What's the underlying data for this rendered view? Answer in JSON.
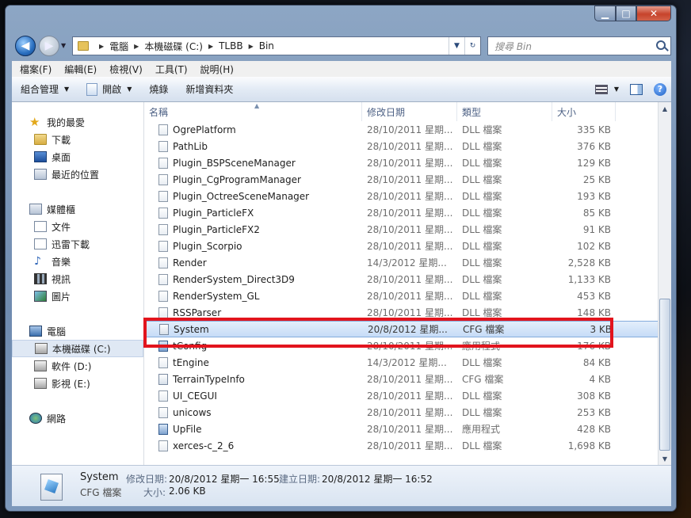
{
  "window_controls": {
    "minimize": "▁",
    "maximize": "□",
    "close": "✕"
  },
  "address": {
    "crumbs": [
      "電腦",
      "本機磁碟 (C:)",
      "TLBB",
      "Bin"
    ]
  },
  "search": {
    "placeholder": "搜尋 Bin"
  },
  "menu": [
    "檔案(F)",
    "編輯(E)",
    "檢視(V)",
    "工具(T)",
    "說明(H)"
  ],
  "toolbar": {
    "organize": "組合管理",
    "open": "開啟",
    "burn": "燒錄",
    "new_folder": "新增資料夾"
  },
  "sidebar": {
    "favorites": {
      "label": "我的最愛",
      "items": [
        "下載",
        "桌面",
        "最近的位置"
      ]
    },
    "libraries": {
      "label": "媒體櫃",
      "items": [
        "文件",
        "迅雷下載",
        "音樂",
        "視訊",
        "圖片"
      ]
    },
    "computer": {
      "label": "電腦",
      "items": [
        "本機磁碟 (C:)",
        "軟件 (D:)",
        "影視 (E:)"
      ]
    },
    "network": {
      "label": "網路"
    }
  },
  "columns": {
    "name": "名稱",
    "modified": "修改日期",
    "type": "類型",
    "size": "大小"
  },
  "files": [
    {
      "name": "OgrePlatform",
      "date": "28/10/2011 星期...",
      "type": "DLL 檔案",
      "size": "335 KB",
      "icon": "file"
    },
    {
      "name": "PathLib",
      "date": "28/10/2011 星期...",
      "type": "DLL 檔案",
      "size": "376 KB",
      "icon": "file"
    },
    {
      "name": "Plugin_BSPSceneManager",
      "date": "28/10/2011 星期...",
      "type": "DLL 檔案",
      "size": "129 KB",
      "icon": "file"
    },
    {
      "name": "Plugin_CgProgramManager",
      "date": "28/10/2011 星期...",
      "type": "DLL 檔案",
      "size": "25 KB",
      "icon": "file"
    },
    {
      "name": "Plugin_OctreeSceneManager",
      "date": "28/10/2011 星期...",
      "type": "DLL 檔案",
      "size": "193 KB",
      "icon": "file"
    },
    {
      "name": "Plugin_ParticleFX",
      "date": "28/10/2011 星期...",
      "type": "DLL 檔案",
      "size": "85 KB",
      "icon": "file"
    },
    {
      "name": "Plugin_ParticleFX2",
      "date": "28/10/2011 星期...",
      "type": "DLL 檔案",
      "size": "91 KB",
      "icon": "file"
    },
    {
      "name": "Plugin_Scorpio",
      "date": "28/10/2011 星期...",
      "type": "DLL 檔案",
      "size": "102 KB",
      "icon": "file"
    },
    {
      "name": "Render",
      "date": "14/3/2012 星期...",
      "type": "DLL 檔案",
      "size": "2,528 KB",
      "icon": "file"
    },
    {
      "name": "RenderSystem_Direct3D9",
      "date": "28/10/2011 星期...",
      "type": "DLL 檔案",
      "size": "1,133 KB",
      "icon": "file"
    },
    {
      "name": "RenderSystem_GL",
      "date": "28/10/2011 星期...",
      "type": "DLL 檔案",
      "size": "453 KB",
      "icon": "file"
    },
    {
      "name": "RSSParser",
      "date": "28/10/2011 星期...",
      "type": "DLL 檔案",
      "size": "148 KB",
      "icon": "file"
    },
    {
      "name": "System",
      "date": "20/8/2012 星期...",
      "type": "CFG 檔案",
      "size": "3 KB",
      "icon": "cfg",
      "selected": true
    },
    {
      "name": "tConfig",
      "date": "28/10/2011 星期...",
      "type": "應用程式",
      "size": "176 KB",
      "icon": "exe"
    },
    {
      "name": "tEngine",
      "date": "14/3/2012 星期...",
      "type": "DLL 檔案",
      "size": "84 KB",
      "icon": "file"
    },
    {
      "name": "TerrainTypeInfo",
      "date": "28/10/2011 星期...",
      "type": "CFG 檔案",
      "size": "4 KB",
      "icon": "cfg"
    },
    {
      "name": "UI_CEGUI",
      "date": "28/10/2011 星期...",
      "type": "DLL 檔案",
      "size": "308 KB",
      "icon": "file"
    },
    {
      "name": "unicows",
      "date": "28/10/2011 星期...",
      "type": "DLL 檔案",
      "size": "253 KB",
      "icon": "file"
    },
    {
      "name": "UpFile",
      "date": "28/10/2011 星期...",
      "type": "應用程式",
      "size": "428 KB",
      "icon": "exe"
    },
    {
      "name": "xerces-c_2_6",
      "date": "28/10/2011 星期...",
      "type": "DLL 檔案",
      "size": "1,698 KB",
      "icon": "file"
    }
  ],
  "details": {
    "name": "System",
    "type": "CFG 檔案",
    "modified_label": "修改日期:",
    "modified": "20/8/2012 星期一 16:55",
    "created_label": "建立日期:",
    "created": "20/8/2012 星期一 16:52",
    "size_label": "大小:",
    "size": "2.06 KB"
  },
  "colors": {
    "selection": "#c6dcf7",
    "highlight_box": "#e2141d"
  }
}
